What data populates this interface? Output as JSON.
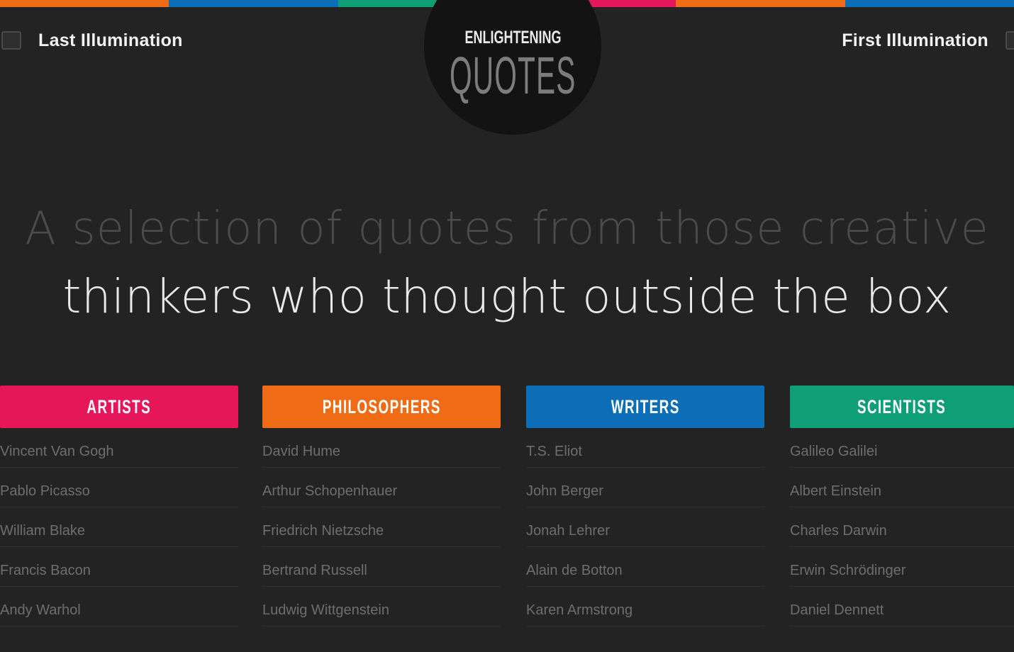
{
  "colors": {
    "background": "#232323",
    "artists": "#e5165a",
    "philosophers": "#ef6b16",
    "writers": "#0b6eb6",
    "scientists": "#0e9f76"
  },
  "top_stripe": [
    "#ef6b16",
    "#0b6eb6",
    "#0e9f76",
    "#e5165a",
    "#ef6b16",
    "#0b6eb6"
  ],
  "nav": {
    "left": {
      "label": "Last Illumination",
      "icon": "square-icon"
    },
    "right": {
      "label": "First Illumination",
      "icon": "square-icon"
    }
  },
  "logo": {
    "small_text": "ENLIGHTENING",
    "big_text": "QUOTES"
  },
  "headline": {
    "line1": "A selection of quotes from those creative",
    "line2": "thinkers who thought outside the box"
  },
  "categories": [
    {
      "label": "ARTISTS",
      "color": "#e5165a",
      "items": [
        "Vincent Van Gogh",
        "Pablo Picasso",
        "William Blake",
        "Francis Bacon",
        "Andy Warhol"
      ]
    },
    {
      "label": "PHILOSOPHERS",
      "color": "#ef6b16",
      "items": [
        "David Hume",
        "Arthur Schopenhauer",
        "Friedrich Nietzsche",
        "Bertrand Russell",
        "Ludwig Wittgenstein"
      ]
    },
    {
      "label": "WRITERS",
      "color": "#0b6eb6",
      "items": [
        "T.S. Eliot",
        "John Berger",
        "Jonah Lehrer",
        "Alain de Botton",
        "Karen Armstrong"
      ]
    },
    {
      "label": "SCIENTISTS",
      "color": "#0e9f76",
      "items": [
        "Galileo Galilei",
        "Albert Einstein",
        "Charles Darwin",
        "Erwin Schrödinger",
        "Daniel Dennett"
      ]
    }
  ]
}
